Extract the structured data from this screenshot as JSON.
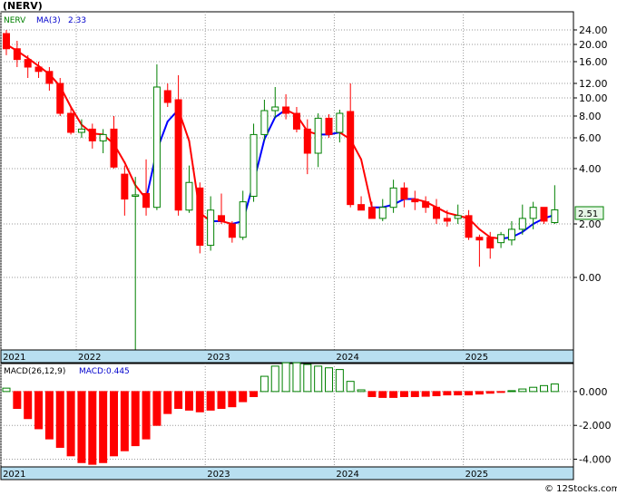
{
  "header": {
    "ticker": "(NERV)"
  },
  "legend": {
    "symbol": "NERV",
    "ma_label": "MA(3)",
    "ma_value": "2.33",
    "symbol_color": "#008000",
    "ma_color": "#0000cc"
  },
  "price_badge": "2.51",
  "macd_legend": {
    "label": "MACD(26,12,9)",
    "value_label": "MACD:0.445",
    "value_color": "#0000cc"
  },
  "watermark": "© 12Stocks.com",
  "colors": {
    "up": "#008000",
    "down": "#ff0000",
    "ma_up": "#0000ff",
    "ma_down": "#ff0000",
    "axis_band": "#b8dff0"
  },
  "chart_data": [
    {
      "type": "candlestick",
      "ticker": "NERV",
      "y_scale": "compressed",
      "ylim": [
        -4,
        26
      ],
      "y_ticks": [
        "24.00",
        "20.00",
        "16.00",
        "12.00",
        "10.00",
        "8.00",
        "6.00",
        "4.00",
        "2.00",
        "0.00"
      ],
      "x_ticks": [
        {
          "label": "2021",
          "index": 0
        },
        {
          "label": "2022",
          "index": 7
        },
        {
          "label": "2023",
          "index": 19
        },
        {
          "label": "2024",
          "index": 31
        },
        {
          "label": "2025",
          "index": 43
        }
      ],
      "last_price": 2.51,
      "ma": {
        "name": "MA(3)",
        "value": 2.33
      },
      "candles": [
        {
          "o": 23,
          "h": 24,
          "l": 17.5,
          "c": 19
        },
        {
          "o": 19,
          "h": 21,
          "l": 15,
          "c": 16.5
        },
        {
          "o": 16.5,
          "h": 17.5,
          "l": 13,
          "c": 15
        },
        {
          "o": 15,
          "h": 16,
          "l": 13,
          "c": 14.2
        },
        {
          "o": 14.2,
          "h": 15,
          "l": 11,
          "c": 12
        },
        {
          "o": 12,
          "h": 13,
          "l": 8,
          "c": 8.3
        },
        {
          "o": 8.3,
          "h": 9,
          "l": 6.3,
          "c": 6.5
        },
        {
          "o": 6.5,
          "h": 7.7,
          "l": 6,
          "c": 6.8
        },
        {
          "o": 6.8,
          "h": 7.3,
          "l": 5.3,
          "c": 5.8
        },
        {
          "o": 5.8,
          "h": 6.8,
          "l": 5,
          "c": 6.3
        },
        {
          "o": 6.8,
          "h": 8,
          "l": 4,
          "c": 4.1
        },
        {
          "o": 3.8,
          "h": 4.2,
          "l": 2.3,
          "c": 2.9
        },
        {
          "o": 3,
          "h": 3.7,
          "l": -4,
          "c": 3.05
        },
        {
          "o": 3.1,
          "h": 4.6,
          "l": 2.3,
          "c": 2.6
        },
        {
          "o": 2.6,
          "h": 15.5,
          "l": 2.5,
          "c": 11.5
        },
        {
          "o": 11,
          "h": 12,
          "l": 9,
          "c": 9.5
        },
        {
          "o": 9.8,
          "h": 13.5,
          "l": 2.3,
          "c": 2.5
        },
        {
          "o": 2.5,
          "h": 4.2,
          "l": 2.4,
          "c": 3.5
        },
        {
          "o": 3.3,
          "h": 3.5,
          "l": 0.9,
          "c": 1.2
        },
        {
          "o": 1.2,
          "h": 3,
          "l": 1,
          "c": 2.5
        },
        {
          "o": 2.3,
          "h": 3.1,
          "l": 2,
          "c": 2.1
        },
        {
          "o": 2,
          "h": 2.1,
          "l": 1.3,
          "c": 1.5
        },
        {
          "o": 1.5,
          "h": 3.2,
          "l": 1.4,
          "c": 2.8
        },
        {
          "o": 3,
          "h": 7.3,
          "l": 2.8,
          "c": 6.3
        },
        {
          "o": 6.3,
          "h": 9.8,
          "l": 5.8,
          "c": 8.6
        },
        {
          "o": 8.6,
          "h": 11.5,
          "l": 7.8,
          "c": 9
        },
        {
          "o": 9,
          "h": 10.5,
          "l": 7.7,
          "c": 8.3
        },
        {
          "o": 8.3,
          "h": 9,
          "l": 6.5,
          "c": 6.8
        },
        {
          "o": 6.8,
          "h": 7.7,
          "l": 3.8,
          "c": 5
        },
        {
          "o": 5,
          "h": 8.3,
          "l": 4.1,
          "c": 7.8
        },
        {
          "o": 7.8,
          "h": 8.2,
          "l": 6,
          "c": 6.3
        },
        {
          "o": 6.5,
          "h": 8.7,
          "l": 5.7,
          "c": 8.3
        },
        {
          "o": 8.5,
          "h": 12,
          "l": 2.6,
          "c": 2.7
        },
        {
          "o": 2.7,
          "h": 3,
          "l": 2.5,
          "c": 2.5
        },
        {
          "o": 2.6,
          "h": 2.8,
          "l": 2.2,
          "c": 2.2
        },
        {
          "o": 2.2,
          "h": 2.9,
          "l": 2.1,
          "c": 2.6
        },
        {
          "o": 2.6,
          "h": 3.6,
          "l": 2.4,
          "c": 3.3
        },
        {
          "o": 3.3,
          "h": 3.5,
          "l": 2.6,
          "c": 2.9
        },
        {
          "o": 2.9,
          "h": 3.2,
          "l": 2.5,
          "c": 2.8
        },
        {
          "o": 2.8,
          "h": 3,
          "l": 2.4,
          "c": 2.6
        },
        {
          "o": 2.6,
          "h": 2.9,
          "l": 2.0,
          "c": 2.2
        },
        {
          "o": 2.2,
          "h": 2.5,
          "l": 1.9,
          "c": 2.1
        },
        {
          "o": 2.2,
          "h": 2.7,
          "l": 2.0,
          "c": 2.3
        },
        {
          "o": 2.3,
          "h": 2.5,
          "l": 1.4,
          "c": 1.5
        },
        {
          "o": 1.5,
          "h": 1.6,
          "l": 0.4,
          "c": 1.4
        },
        {
          "o": 1.5,
          "h": 1.7,
          "l": 0.7,
          "c": 1.1
        },
        {
          "o": 1.3,
          "h": 1.7,
          "l": 1.1,
          "c": 1.6
        },
        {
          "o": 1.4,
          "h": 2.1,
          "l": 1.2,
          "c": 1.8
        },
        {
          "o": 1.8,
          "h": 2.7,
          "l": 1.6,
          "c": 2.2
        },
        {
          "o": 2.2,
          "h": 2.8,
          "l": 1.8,
          "c": 2.6
        },
        {
          "o": 2.6,
          "h": 2.5,
          "l": 2.0,
          "c": 2.1
        },
        {
          "o": 2.05,
          "h": 3.4,
          "l": 2.0,
          "c": 2.51
        }
      ],
      "ma_values": [
        20,
        18.5,
        16.8,
        15.2,
        13.7,
        11.6,
        9.0,
        7.2,
        6.4,
        6.3,
        5.6,
        4.4,
        3.4,
        2.9,
        5.2,
        7.5,
        8.7,
        5.8,
        2.4,
        2.1,
        2.1,
        2.0,
        2.1,
        3.5,
        5.9,
        7.9,
        8.7,
        8.1,
        6.6,
        6.3,
        6.3,
        6.5,
        5.9,
        4.6,
        2.6,
        2.6,
        2.7,
        2.9,
        2.9,
        2.8,
        2.6,
        2.4,
        2.3,
        2.2,
        1.8,
        1.5,
        1.45,
        1.5,
        1.7,
        2.0,
        2.2,
        2.33
      ]
    },
    {
      "type": "bar",
      "name": "MACD(26,12,9)",
      "value": 0.445,
      "y_ticks": [
        "0.000",
        "-2.000",
        "-4.000"
      ],
      "ylim": [
        -4.4,
        1.6
      ],
      "x_ticks": [
        {
          "label": "2021",
          "index": 0
        },
        {
          "label": "2023",
          "index": 19
        },
        {
          "label": "2024",
          "index": 31
        },
        {
          "label": "2025",
          "index": 43
        }
      ],
      "values": [
        0.2,
        -1.0,
        -1.6,
        -2.2,
        -2.8,
        -3.3,
        -3.8,
        -4.2,
        -4.3,
        -4.2,
        -3.8,
        -3.5,
        -3.2,
        -2.8,
        -2.0,
        -1.3,
        -1.0,
        -1.1,
        -1.2,
        -1.1,
        -1.0,
        -0.9,
        -0.6,
        -0.3,
        0.9,
        1.5,
        1.7,
        1.7,
        1.6,
        1.5,
        1.4,
        1.3,
        0.6,
        0.1,
        -0.3,
        -0.35,
        -0.35,
        -0.3,
        -0.3,
        -0.28,
        -0.25,
        -0.2,
        -0.2,
        -0.2,
        -0.15,
        -0.1,
        -0.05,
        0.05,
        0.15,
        0.25,
        0.35,
        0.445
      ]
    }
  ]
}
